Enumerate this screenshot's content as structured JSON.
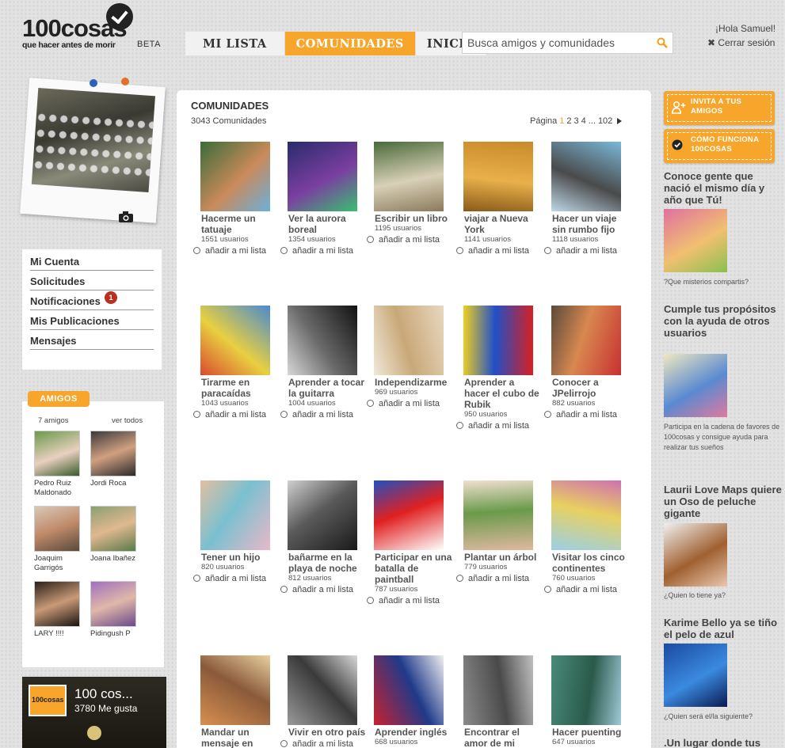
{
  "header": {
    "logo_text": "100cosas",
    "tagline": "que hacer antes de morir",
    "beta": "BETA",
    "nav": [
      "MI LISTA",
      "COMUNIDADES",
      "INICIO"
    ],
    "active_nav": "COMUNIDADES",
    "search_placeholder": "Busca amigos y comunidades",
    "greeting": "¡Hola Samuel!",
    "logout": "✖ Cerrar sesión"
  },
  "sidebar": {
    "menu": [
      "Mi Cuenta",
      "Solicitudes",
      "Notificaciones",
      "Mis Publicaciones",
      "Mensajes"
    ],
    "notifications_count": "1",
    "friends_tab": "AMIGOS",
    "friends_count": "7 amigos",
    "see_all": "ver todos",
    "friends": [
      {
        "name": "Pedro Ruiz Maldonado"
      },
      {
        "name": "Jordi Roca"
      },
      {
        "name": "Joaquim Garrigós"
      },
      {
        "name": "Joana Ibañez"
      },
      {
        "name": "LARY !!!!"
      },
      {
        "name": "Pidingush P"
      }
    ],
    "fb": {
      "title": "100 cos...",
      "likes": "3780 Me gusta",
      "logo": "100cosas"
    }
  },
  "main": {
    "title": "COMUNIDADES",
    "count": "3043 Comunidades",
    "pager": {
      "label": "Página",
      "pages": [
        "1",
        "2",
        "3",
        "4"
      ],
      "ellipsis": "...",
      "last": "102",
      "current": "1"
    },
    "add_label": "añadir a mi lista",
    "cards": [
      {
        "title": "Hacerme un tatuaje",
        "users": "1551 usuarios",
        "colors": [
          "#3b6b3a",
          "#c98a5a",
          "#6ab0d9"
        ]
      },
      {
        "title": "Ver la aurora boreal",
        "users": "1354 usuarios",
        "colors": [
          "#2a2b6b",
          "#7a3fa0",
          "#39c070"
        ]
      },
      {
        "title": "Escribir un libro",
        "users": "1195 usuarios",
        "colors": [
          "#4a6a3a",
          "#d8d0b8",
          "#8a7a5a"
        ]
      },
      {
        "title": "viajar a Nueva York",
        "users": "1141 usuarios",
        "colors": [
          "#c98a2a",
          "#e8b04a",
          "#8a5a1a"
        ]
      },
      {
        "title": "Hacer un viaje sin rumbo fijo",
        "users": "1118 usuarios",
        "colors": [
          "#7ab8d8",
          "#4a4a4a",
          "#bfd8e8"
        ]
      },
      {
        "title": "Tirarme en paracaídas",
        "users": "1043 usuarios",
        "colors": [
          "#4a8ad0",
          "#e8d040",
          "#d84a30"
        ]
      },
      {
        "title": "Aprender a tocar la guitarra",
        "users": "1004 usuarios",
        "colors": [
          "#111111",
          "#6a6a6a",
          "#d8d8d8"
        ]
      },
      {
        "title": "Independizarme",
        "users": "969 usuarios",
        "colors": [
          "#e8d8c0",
          "#c8a878",
          "#f0e8d8"
        ]
      },
      {
        "title": "Aprender a hacer el cubo de Rubik",
        "users": "950 usuarios",
        "colors": [
          "#d82020",
          "#2050c8",
          "#f0d020"
        ]
      },
      {
        "title": "Conocer a JPelirrojo",
        "users": "882 usuarios",
        "colors": [
          "#c83030",
          "#d88850",
          "#5a4a3a"
        ]
      },
      {
        "title": "Tener un hijo",
        "users": "820 usuarios",
        "colors": [
          "#e8b8c8",
          "#7ac0d0",
          "#e0c0a0"
        ]
      },
      {
        "title": "bañarme en la playa de noche",
        "users": "812 usuarios",
        "colors": [
          "#1a1a1a",
          "#5a5a5a",
          "#d0d0d0"
        ]
      },
      {
        "title": "Participar en una batalla de paintball",
        "users": "787 usuarios",
        "colors": [
          "#ffffff",
          "#e02020",
          "#2050c0"
        ]
      },
      {
        "title": "Plantar un árbol",
        "users": "779 usuarios",
        "colors": [
          "#e0b8a0",
          "#6a9a4a",
          "#f0e0d0"
        ]
      },
      {
        "title": "Visitar los cinco continentes",
        "users": "760 usuarios",
        "colors": [
          "#9ad0e8",
          "#e8d060",
          "#d070b0"
        ]
      },
      {
        "title": "Mandar un mensaje en",
        "users": "",
        "colors": [
          "#d89050",
          "#8a5a3a",
          "#e8d0a0"
        ]
      },
      {
        "title": "Vivir en otro país",
        "users": "",
        "colors": [
          "#9a9a9a",
          "#3a3a3a",
          "#d8d8d8"
        ]
      },
      {
        "title": "Aprender inglés",
        "users": "668 usuarios",
        "colors": [
          "#c82030",
          "#203a8a",
          "#f0f0f0"
        ]
      },
      {
        "title": "Encontrar el amor de mi",
        "users": "",
        "colors": [
          "#8a8a8a",
          "#4a4a4a",
          "#c0c0c0"
        ]
      },
      {
        "title": "Hacer puenting",
        "users": "647 usuarios",
        "colors": [
          "#4a8a7a",
          "#2a5a4a",
          "#a0c8d8"
        ]
      }
    ]
  },
  "right": {
    "invite": "INVITA A TUS AMIGOS",
    "how": "CÓMO FUNCIONA 100COSAS",
    "blocks": [
      {
        "title": "Conoce gente que nació el mismo día y año que Tú!",
        "sub": "?Que misterios compartis?",
        "colors": [
          "#e070a0",
          "#f0c070",
          "#8ac050"
        ]
      },
      {
        "title": "Cumple tus propósitos con la ayuda de otros usuarios",
        "sub": "Participa en la cadena de favores de 100cosas y consigue ayuda para realizar tus sueños",
        "colors": [
          "#f0e8c0",
          "#5a8ad0",
          "#e07aa0"
        ]
      },
      {
        "title": "Laurii Love Maps quiere un Oso de peluche gigante",
        "sub": "¿Quien lo tiene ya?",
        "colors": [
          "#f0f0f0",
          "#a06030",
          "#e8c8b0"
        ]
      },
      {
        "title": "Karime Bello ya se tiño el pelo de azul",
        "sub": "¿Quien será el/la siguiente?",
        "colors": [
          "#1a4aa0",
          "#3a8ae0",
          "#0a1a50"
        ]
      },
      {
        "title": ".Un lugar donde tus",
        "sub": "",
        "colors": [
          "#cccccc",
          "#cccccc",
          "#cccccc"
        ]
      }
    ]
  }
}
